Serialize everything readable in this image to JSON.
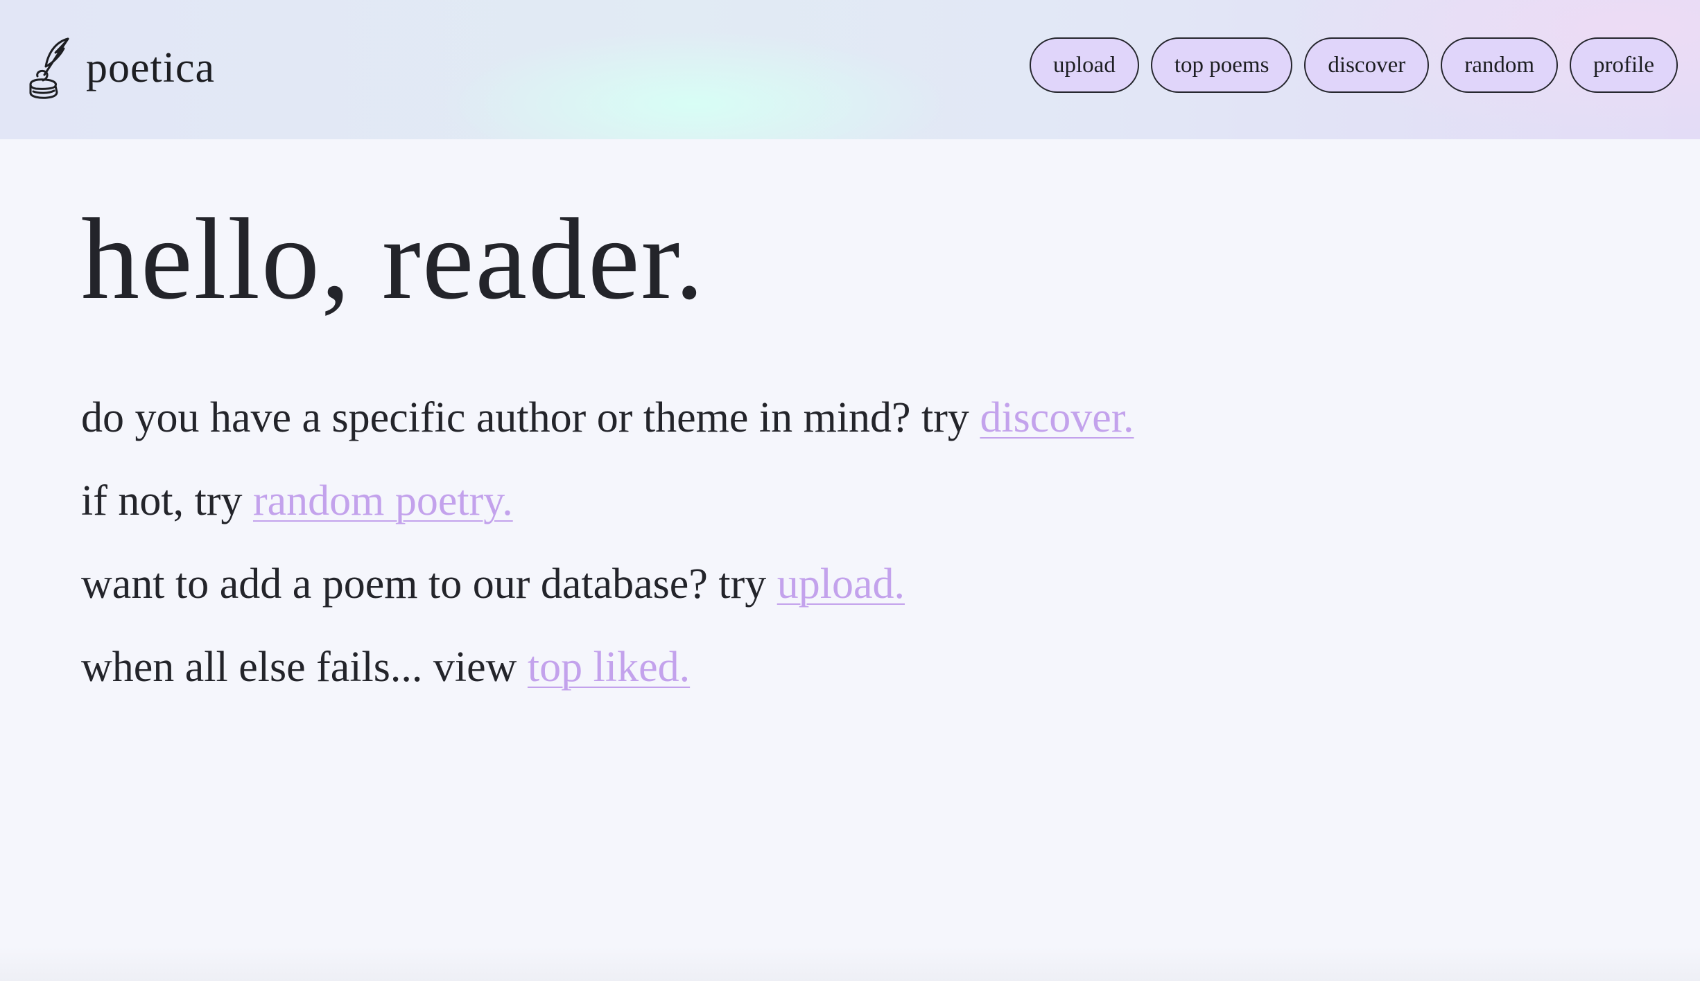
{
  "header": {
    "brand_name": "poetica",
    "logo_icon": "quill-inkwell-icon",
    "nav": [
      {
        "label": "upload"
      },
      {
        "label": "top poems"
      },
      {
        "label": "discover"
      },
      {
        "label": "random"
      },
      {
        "label": "profile"
      }
    ]
  },
  "main": {
    "greeting": "hello, reader.",
    "lines": [
      {
        "text": "do you have a specific author or theme in mind? try ",
        "link": "discover."
      },
      {
        "text": "if not, try ",
        "link": "random poetry."
      },
      {
        "text": "want to add a poem to our database? try ",
        "link": "upload."
      },
      {
        "text": "when all else fails... view ",
        "link": "top liked."
      }
    ]
  },
  "colors": {
    "background": "#f5f6fc",
    "nav_button_fill": "#e0d5fa",
    "link": "#c3a2ec",
    "text": "#23242a"
  }
}
